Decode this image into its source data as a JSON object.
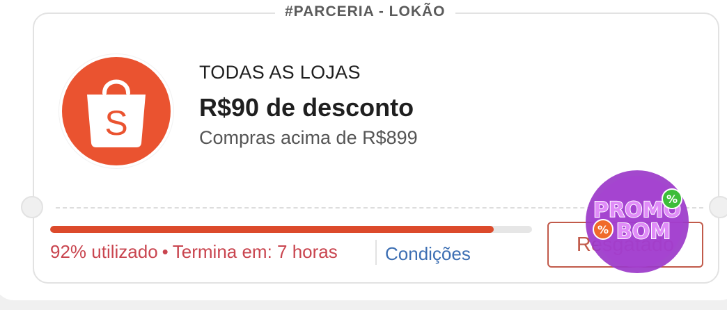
{
  "coupon": {
    "tag": "#PARCERIA - LOKÃO",
    "store_scope": "TODAS AS LOJAS",
    "discount": "R$90 de desconto",
    "minimum": "Compras acima de R$899",
    "usage_percent": 92,
    "usage_label": "92% utilizado",
    "expiry": "Termina em: 7 horas",
    "conditions_label": "Condições",
    "redeem_label": "Resgatado"
  },
  "logo": {
    "icon": "shopping-bag-icon",
    "letter": "S",
    "color": "#ea5330"
  },
  "watermark": {
    "line1": "PROMO",
    "line2": "BOM",
    "colors": {
      "circle": "#9b38c9",
      "text": "#d06cf0",
      "badge_green": "#3dbd3a",
      "badge_orange": "#f06a2a"
    }
  },
  "colors": {
    "progress_fill": "#dc4a2b",
    "usage_text": "#c9454f",
    "link": "#3d6fb3",
    "button_border": "#c15a4a"
  }
}
